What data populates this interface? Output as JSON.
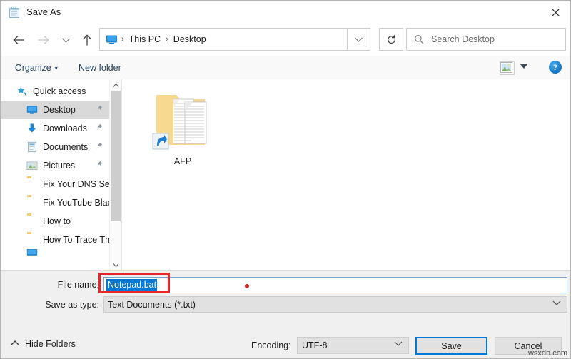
{
  "window": {
    "title": "Save As",
    "title_icon": "notepad-icon",
    "close_label": "✕"
  },
  "nav": {
    "back_icon": "←",
    "forward_icon": "→",
    "recent_icon": "⌄",
    "up_icon": "↑",
    "dropdown_icon": "⌄",
    "refresh_icon": "↻",
    "breadcrumbs": [
      {
        "label": "This PC"
      },
      {
        "label": "Desktop"
      }
    ],
    "separator": "›",
    "address_icon": "this-pc-icon"
  },
  "search": {
    "placeholder": "Search Desktop",
    "icon": "search-icon"
  },
  "toolbar": {
    "organize_label": "Organize",
    "organize_caret": "▾",
    "new_folder_label": "New folder",
    "view_icon": "view-layout-icon",
    "view_caret": "chevron-down-icon",
    "help_label": "?"
  },
  "sidebar": {
    "items": [
      {
        "label": "Quick access",
        "icon": "star-pin-icon",
        "indent": 0,
        "selected": false,
        "pinned": false
      },
      {
        "label": "Desktop",
        "icon": "monitor-icon",
        "indent": 1,
        "selected": true,
        "pinned": true
      },
      {
        "label": "Downloads",
        "icon": "download-arrow-icon",
        "indent": 1,
        "selected": false,
        "pinned": true
      },
      {
        "label": "Documents",
        "icon": "document-icon",
        "indent": 1,
        "selected": false,
        "pinned": true
      },
      {
        "label": "Pictures",
        "icon": "pictures-icon",
        "indent": 1,
        "selected": false,
        "pinned": true
      },
      {
        "label": "Fix Your DNS Ser",
        "icon": "folder-icon",
        "indent": 1,
        "selected": false,
        "pinned": false
      },
      {
        "label": "Fix YouTube Blac",
        "icon": "folder-icon",
        "indent": 1,
        "selected": false,
        "pinned": false
      },
      {
        "label": "How to",
        "icon": "folder-icon",
        "indent": 1,
        "selected": false,
        "pinned": false
      },
      {
        "label": "How To Trace Th",
        "icon": "folder-icon",
        "indent": 1,
        "selected": false,
        "pinned": false
      }
    ],
    "scroll_up_icon": "⌃",
    "scroll_down_icon": "⌄"
  },
  "files": [
    {
      "name": "AFP",
      "icon": "folder-shortcut-icon"
    }
  ],
  "form": {
    "filename_label": "File name:",
    "filename_value": "Notepad.bat",
    "savetype_label": "Save as type:",
    "savetype_value": "Text Documents (*.txt)",
    "savetype_caret": "⌄",
    "hide_folders_label": "Hide Folders",
    "hide_folders_caret": "⌃",
    "encoding_label": "Encoding:",
    "encoding_value": "UTF-8",
    "encoding_caret": "⌄",
    "save_button": "Save",
    "cancel_button": "Cancel"
  },
  "annotations": {
    "highlight_color": "#e8262a",
    "dot_color": "#cf2b2b",
    "watermark": "wsxdn.com"
  },
  "colors": {
    "selection_blue": "#0078d7",
    "accent_border": "#0078d7",
    "selected_row": "#d9d9d9",
    "dialog_bg": "#f0f0f0"
  }
}
